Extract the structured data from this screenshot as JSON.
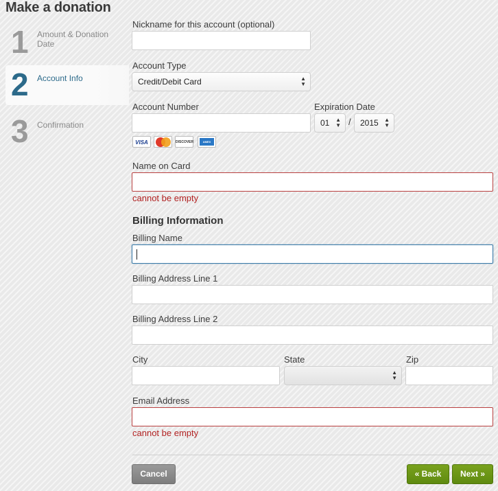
{
  "page_title": "Make a donation",
  "steps": [
    {
      "number": "1",
      "label": "Amount & Donation Date",
      "active": false
    },
    {
      "number": "2",
      "label": "Account Info",
      "active": true
    },
    {
      "number": "3",
      "label": "Confirmation",
      "active": false
    }
  ],
  "form": {
    "nickname": {
      "label": "Nickname for this account (optional)",
      "value": ""
    },
    "account_type": {
      "label": "Account Type",
      "value": "Credit/Debit Card"
    },
    "account_number": {
      "label": "Account Number",
      "value": ""
    },
    "expiration": {
      "label": "Expiration Date",
      "month": "01",
      "separator": "/",
      "year": "2015"
    },
    "cards": [
      "VISA",
      "MasterCard",
      "DISCOVER",
      "AMEX"
    ],
    "name_on_card": {
      "label": "Name on Card",
      "value": "",
      "error": "cannot be empty"
    },
    "billing_heading": "Billing Information",
    "billing_name": {
      "label": "Billing Name",
      "value": ""
    },
    "address1": {
      "label": "Billing Address Line 1",
      "value": ""
    },
    "address2": {
      "label": "Billing Address Line 2",
      "value": ""
    },
    "city": {
      "label": "City",
      "value": ""
    },
    "state": {
      "label": "State",
      "value": ""
    },
    "zip": {
      "label": "Zip",
      "value": ""
    },
    "email": {
      "label": "Email Address",
      "value": "",
      "error": "cannot be empty"
    }
  },
  "buttons": {
    "cancel": "Cancel",
    "back": "« Back",
    "next": "Next »"
  },
  "colors": {
    "accent": "#2c6a8a",
    "error": "#b22222",
    "primary_button": "#6b9416",
    "cancel_button": "#8a8a8a"
  }
}
